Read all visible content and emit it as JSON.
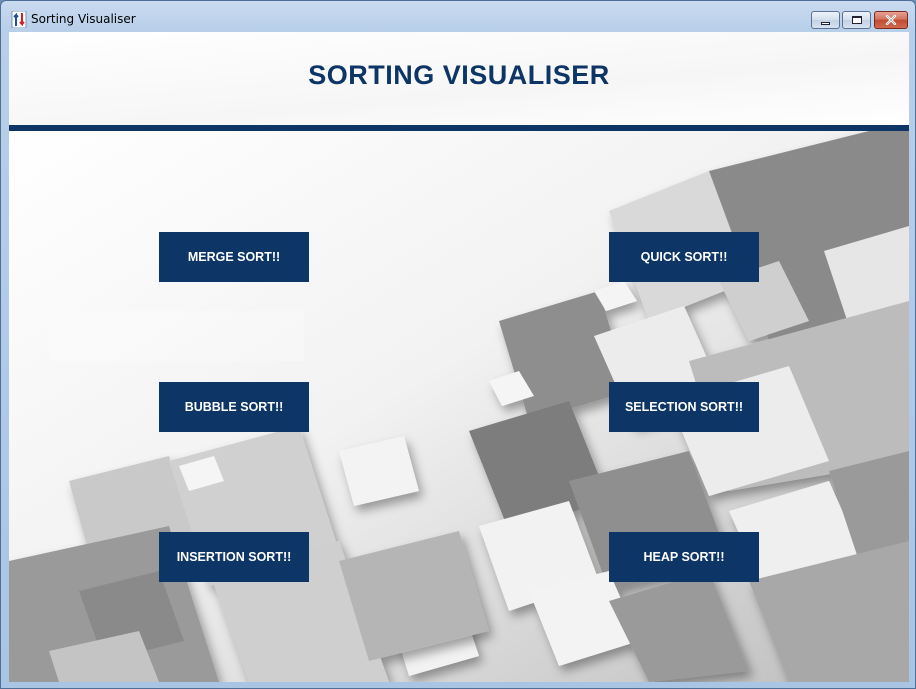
{
  "window": {
    "title": "Sorting Visualiser",
    "controls": [
      "minimize",
      "maximize",
      "close"
    ]
  },
  "header": {
    "title": "SORTING VISUALISER",
    "accent_color": "#0d3566"
  },
  "buttons": {
    "merge": "MERGE SORT!!",
    "quick": "QUICK SORT!!",
    "bubble": "BUBBLE SORT!!",
    "selection": "SELECTION SORT!!",
    "insertion": "INSERTION SORT!!",
    "heap": "HEAP SORT!!"
  },
  "icons": {
    "app": "sort-arrows-icon",
    "minimize": "minimize-icon",
    "maximize": "maximize-icon",
    "close": "close-icon"
  }
}
